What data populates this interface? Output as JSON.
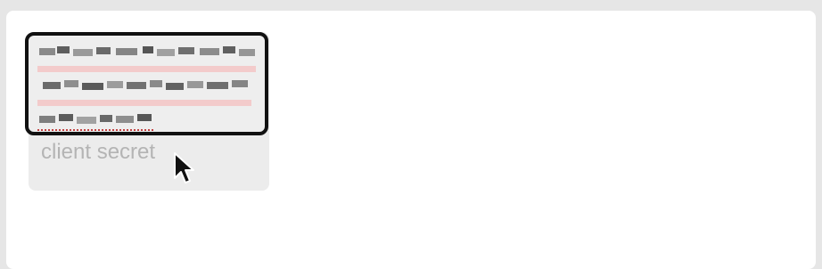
{
  "form": {
    "secret_value_obscured": true,
    "client_secret_placeholder": "client secret"
  },
  "colors": {
    "background": "#e6e6e6",
    "panel": "#ffffff",
    "field_bg": "#ececec",
    "focus_border": "#111111",
    "placeholder_text": "#b4b4b4",
    "spellcheck_underline": "#c04040"
  },
  "icons": {
    "cursor": "arrow-cursor-icon"
  }
}
